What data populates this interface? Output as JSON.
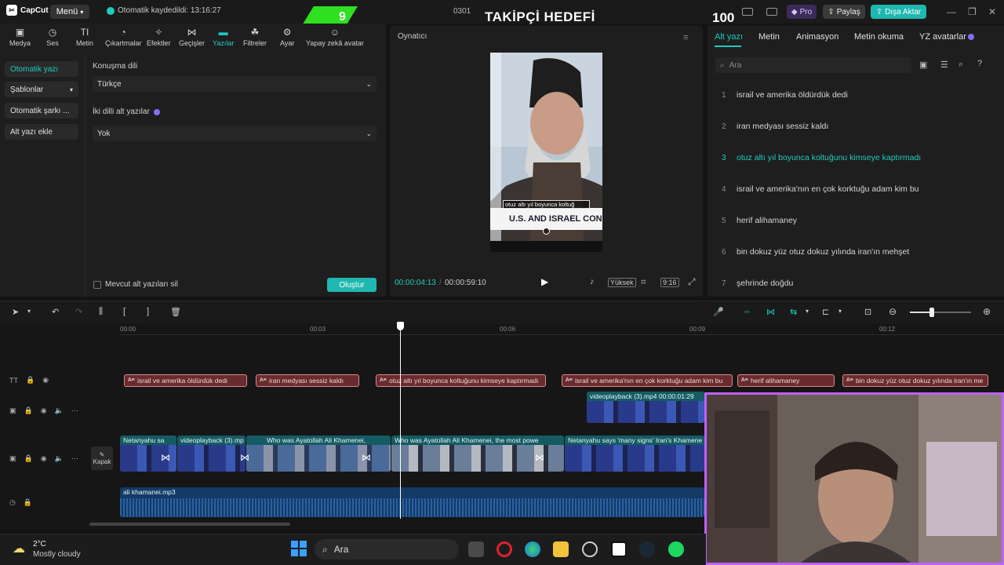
{
  "titlebar": {
    "app_name": "CapCut",
    "menu_label": "Menü",
    "autosave_text": "Otomatik kaydedildi: 13:16:27",
    "project_name": "0301",
    "pro_label": "Pro",
    "share_label": "Paylaş",
    "export_label": "Dışa Aktar"
  },
  "overlay": {
    "goal_title": "TAKİPÇİ HEDEFİ",
    "goal_current": "9",
    "goal_target": "100"
  },
  "toolbar": {
    "items": [
      {
        "label": "Medya",
        "icon": "media-icon"
      },
      {
        "label": "Ses",
        "icon": "audio-icon"
      },
      {
        "label": "Metin",
        "icon": "text-icon"
      },
      {
        "label": "Çıkartmalar",
        "icon": "sticker-icon"
      },
      {
        "label": "Efektler",
        "icon": "effects-icon"
      },
      {
        "label": "Geçişler",
        "icon": "transitions-icon"
      },
      {
        "label": "Yazılar",
        "icon": "captions-icon"
      },
      {
        "label": "Filtreler",
        "icon": "filters-icon"
      },
      {
        "label": "Ayar",
        "icon": "adjust-icon"
      },
      {
        "label": "Yapay zekâ avatar",
        "icon": "ai-avatar-icon"
      }
    ],
    "active": "Yazılar"
  },
  "side_nav": {
    "items": [
      {
        "label": "Otomatik yazı"
      },
      {
        "label": "Şablonlar"
      },
      {
        "label": "Otomatik şarkı ..."
      },
      {
        "label": "Alt yazı ekle"
      }
    ]
  },
  "caption_panel": {
    "language_label": "Konuşma dili",
    "language_value": "Türkçe",
    "bilingual_label": "İki dilli alt yazılar",
    "bilingual_value": "Yok",
    "delete_existing_label": "Mevcut alt yazıları sil",
    "create_label": "Oluştur"
  },
  "player": {
    "title": "Oynatıcı",
    "current_time": "00:00:04:13",
    "total_time": "00:00:59:10",
    "quality_label": "Yüksek",
    "aspect_label": "9:16",
    "subtitle_text": "otuz altı yıl boyunca koltuğ",
    "video_text": "U.S. AND ISRAEL CONI"
  },
  "right_panel": {
    "tabs": [
      "Alt yazı",
      "Metin",
      "Animasyon",
      "Metin okuma",
      "YZ avatarlar"
    ],
    "active_tab": "Alt yazı",
    "search_placeholder": "Ara",
    "subtitles": [
      {
        "num": "1",
        "text": "israil ve amerika öldürdük dedi"
      },
      {
        "num": "2",
        "text": "iran medyası sessiz kaldı"
      },
      {
        "num": "3",
        "text": "otuz altı yıl boyunca koltuğunu kimseye kaptırmadı"
      },
      {
        "num": "4",
        "text": "israil ve amerika'nın en çok korktuğu adam kim bu"
      },
      {
        "num": "5",
        "text": "herif alihamaney"
      },
      {
        "num": "6",
        "text": "bin dokuz yüz otuz dokuz yılında iran'ın mehşet"
      },
      {
        "num": "7",
        "text": "şehrinde doğdu"
      }
    ],
    "active_index": 2
  },
  "timeline": {
    "ruler": [
      "00:00",
      "00:03",
      "00:06",
      "00:09",
      "00:12"
    ],
    "caption_clips": [
      "israil ve amerika öldürdük dedi",
      "iran medyası sessiz kaldı",
      "otuz altı yıl boyunca koltuğunu kimseye kaptırmadı",
      "israil ve amerika'nın en çok korktuğu adam kim bu",
      "herif alihamaney",
      "bin dokuz yüz otuz dokuz yılında iran'ın me"
    ],
    "overlay_clip": "videoplayback (3).mp4  00:00:01:29",
    "main_clips": [
      "Netanyahu sa",
      "videoplayback (3).mp",
      "Who was Ayatollah Ali Khamenei,",
      "Who was Ayatollah Ali Khamenei, the most powe",
      "Netanyahu says 'many signs' Iran's Khamene"
    ],
    "cover_label": "Kapak",
    "audio_clip": "ali khamanei.mp3"
  },
  "taskbar": {
    "weather_temp": "2°C",
    "weather_desc": "Mostly cloudy",
    "search_placeholder": "Ara"
  },
  "colors": {
    "accent": "#1fcbbf",
    "caption_clip": "#6a2b2f",
    "video_clip": "#155b63",
    "audio_clip": "#143a66",
    "webcam_border": "#c060ff",
    "goal_green": "#2ee01f"
  }
}
